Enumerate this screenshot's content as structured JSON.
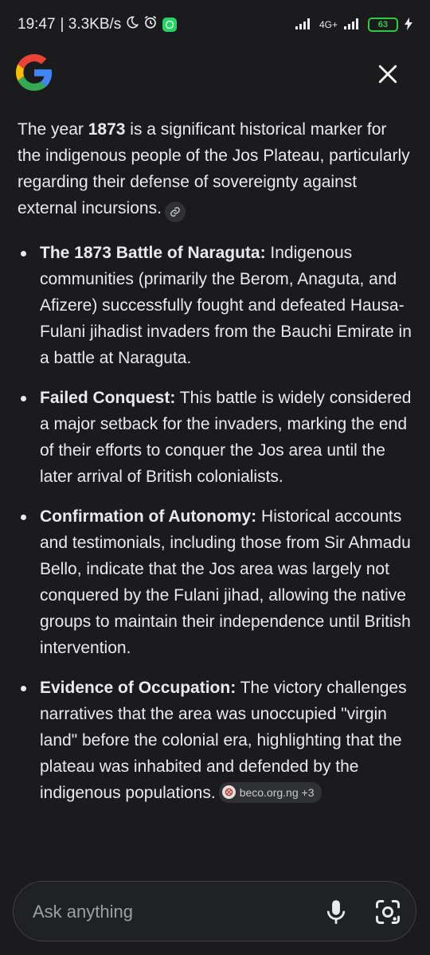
{
  "status_bar": {
    "time": "19:47",
    "speed": "| 3.3KB/s",
    "network": "4G+",
    "battery": "63"
  },
  "intro": {
    "pre": "The year ",
    "bold": "1873",
    "post": " is a significant historical marker for the indigenous people of the Jos Plateau, particularly regarding their defense of sovereignty against external incursions."
  },
  "points": [
    {
      "title": "The 1873 Battle of Naraguta:",
      "text": " Indigenous communities (primarily the Berom, Anaguta, and Afizere) successfully fought and defeated Hausa-Fulani jihadist invaders from the Bauchi Emirate in a battle at Naraguta."
    },
    {
      "title": "Failed Conquest:",
      "text": " This battle is widely considered a major setback for the invaders, marking the end of their efforts to conquer the Jos area until the later arrival of British colonialists."
    },
    {
      "title": "Confirmation of Autonomy:",
      "text": " Historical accounts and testimonials, including those from Sir Ahmadu Bello, indicate that the Jos area was largely not conquered by the Fulani jihad, allowing the native groups to maintain their independence until British intervention."
    },
    {
      "title": "Evidence of Occupation:",
      "text": " The victory challenges narratives that the area was unoccupied \"virgin land\" before the colonial era, highlighting that the plateau was inhabited and defended by the indigenous populations."
    }
  ],
  "source_chip": {
    "label": "beco.org.ng +3"
  },
  "ask_bar": {
    "placeholder": "Ask anything"
  },
  "icons": {
    "logo": "google-g-icon",
    "close": "close-icon",
    "link": "link-icon",
    "mic": "mic-icon",
    "lens": "lens-icon"
  },
  "colors": {
    "background": "#1b1b1d",
    "text": "#e8eaed",
    "chip": "#303134",
    "battery": "#2ecc40"
  }
}
